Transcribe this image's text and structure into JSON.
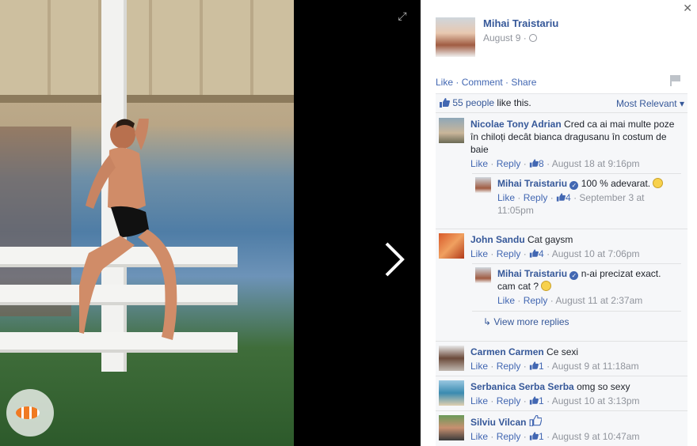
{
  "post": {
    "author_name": "Mihai Traistariu",
    "date": "August 9 · ",
    "privacy_icon": "globe-icon"
  },
  "actions": {
    "like": "Like",
    "comment": "Comment",
    "share": "Share",
    "sep": " · "
  },
  "likes_summary": {
    "count_link": "55 people",
    "suffix": " like this.",
    "sort": "Most Relevant ▾"
  },
  "comments": [
    {
      "name": "Nicolae Tony Adrian",
      "text": "Cred ca ai mai multe poze în chiloți decât bianca dragusanu în costum de baie",
      "like": "Like",
      "reply": "Reply",
      "likes": "8",
      "time": "August 18 at 9:16pm",
      "replies": [
        {
          "name": "Mihai Traistariu",
          "text": "100 % adevarat.",
          "like": "Like",
          "reply": "Reply",
          "likes": "4",
          "time": "September 3 at 11:05pm"
        }
      ]
    },
    {
      "name": "John Sandu",
      "text": "Cat gaysm",
      "like": "Like",
      "reply": "Reply",
      "likes": "4",
      "time": "August 10 at 7:06pm",
      "replies": [
        {
          "name": "Mihai Traistariu",
          "text": "n-ai precizat exact. cam cat ?",
          "like": "Like",
          "reply": "Reply",
          "likes": "",
          "time": "August 11 at 2:37am"
        }
      ],
      "view_more": "View more replies"
    },
    {
      "name": "Carmen Carmen",
      "text": "Ce sexi",
      "like": "Like",
      "reply": "Reply",
      "likes": "1",
      "time": "August 9 at 11:18am"
    },
    {
      "name": "Serbanica Serba Serba",
      "text": "omg so sexy",
      "like": "Like",
      "reply": "Reply",
      "likes": "1",
      "time": "August 10 at 3:13pm"
    },
    {
      "name": "Silviu Vilcan",
      "text": "",
      "like": "Like",
      "reply": "Reply",
      "likes": "1",
      "time": "August 9 at 10:47am"
    }
  ],
  "colors": {
    "link": "#365899",
    "action": "#4267b2",
    "meta": "#90949c",
    "panel_bg": "#f6f7f9"
  }
}
